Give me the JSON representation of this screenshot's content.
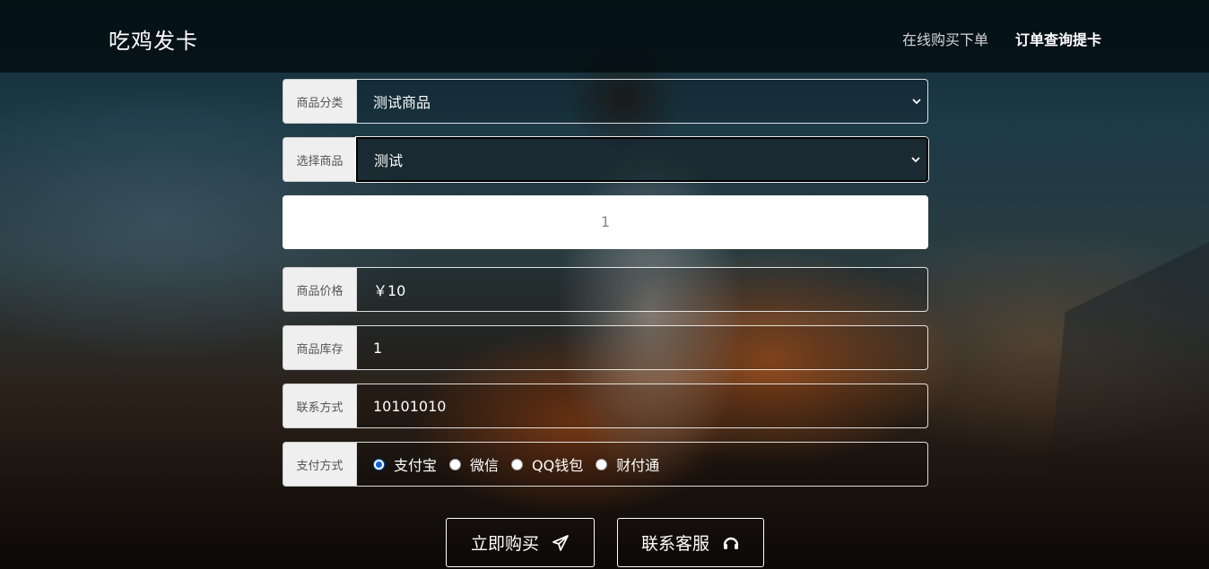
{
  "header": {
    "brand": "吃鸡发卡",
    "nav": [
      {
        "label": "在线购买下单"
      },
      {
        "label": "订单查询提卡"
      }
    ]
  },
  "form": {
    "category": {
      "label": "商品分类",
      "value": "测试商品"
    },
    "product": {
      "label": "选择商品",
      "value": "测试"
    },
    "quantity": {
      "value": "1"
    },
    "price": {
      "label": "商品价格",
      "value": "￥10"
    },
    "stock": {
      "label": "商品库存",
      "value": "1"
    },
    "contact": {
      "label": "联系方式",
      "value": "10101010"
    },
    "payment": {
      "label": "支付方式",
      "selected": "支付宝",
      "options": [
        {
          "label": "支付宝"
        },
        {
          "label": "微信"
        },
        {
          "label": "QQ钱包"
        },
        {
          "label": "财付通"
        }
      ]
    }
  },
  "buttons": {
    "buy": "立即购买",
    "service": "联系客服"
  },
  "icons": {
    "buy": "paper-plane-icon",
    "service": "headset-icon",
    "select": "chevron-down-icon"
  }
}
